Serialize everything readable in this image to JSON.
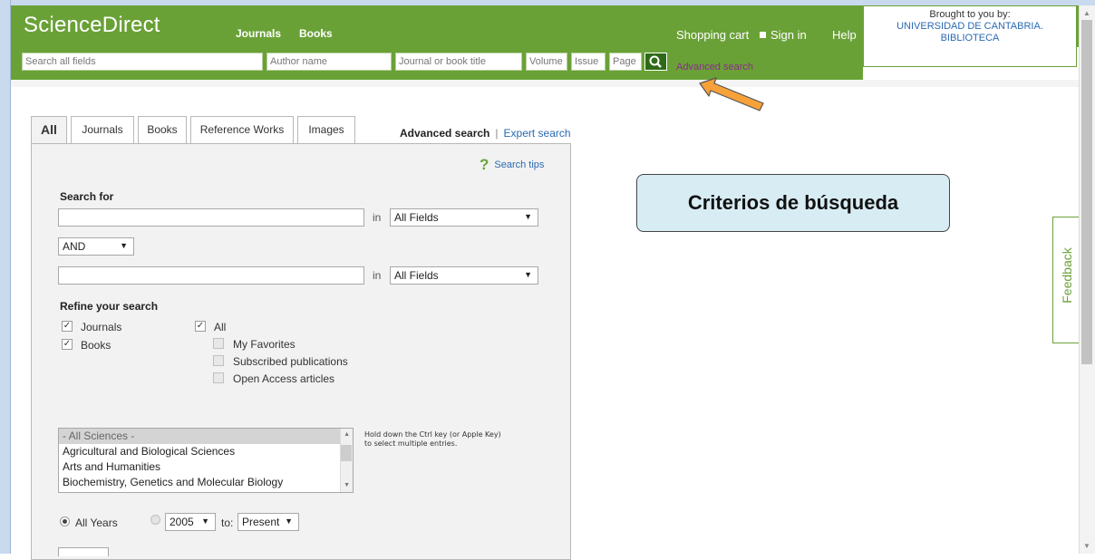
{
  "header": {
    "logo": "ScienceDirect",
    "nav": [
      "Journals",
      "Books"
    ],
    "shopping_cart": "Shopping cart",
    "sign_in": "Sign in",
    "help": "Help",
    "brought_label": "Brought to you by:",
    "institution_line1": "UNIVERSIDAD DE CANTABRIA.",
    "institution_line2": "BIBLIOTECA",
    "brand_color": "#6aa137"
  },
  "quick_search": {
    "all_fields_placeholder": "Search all fields",
    "author_placeholder": "Author name",
    "journal_placeholder": "Journal or book title",
    "volume_placeholder": "Volume",
    "issue_placeholder": "Issue",
    "page_placeholder": "Page",
    "advanced_link": "Advanced search"
  },
  "tabs": [
    "All",
    "Journals",
    "Books",
    "Reference Works",
    "Images"
  ],
  "search_mode": {
    "current": "Advanced search",
    "separator": "|",
    "expert": "Expert search"
  },
  "form": {
    "tips_label": "Search tips",
    "search_for_label": "Search for",
    "in_label": "in",
    "field1_select": "All Fields",
    "operator_select": "AND",
    "field2_select": "All Fields",
    "refine_label": "Refine your search",
    "content_types": [
      {
        "label": "Journals",
        "checked": true
      },
      {
        "label": "Books",
        "checked": true
      }
    ],
    "access_all": {
      "label": "All",
      "checked": true
    },
    "access_options": [
      {
        "label": "My Favorites",
        "checked": false
      },
      {
        "label": "Subscribed publications",
        "checked": false
      },
      {
        "label": "Open Access articles",
        "checked": false
      }
    ],
    "subjects": [
      "- All Sciences -",
      "Agricultural and Biological Sciences",
      "Arts and Humanities",
      "Biochemistry, Genetics and Molecular Biology"
    ],
    "multi_select_hint_line1": "Hold down the Ctrl key (or Apple Key)",
    "multi_select_hint_line2": "to select multiple entries.",
    "all_years_label": "All Years",
    "from_year": "2005",
    "to_label": "to:",
    "to_year": "Present"
  },
  "annotation": {
    "callout": "Criterios de búsqueda",
    "callout_bg": "#d8ecf4",
    "arrow_color": "#f7a13a"
  },
  "feedback_tab": "Feedback"
}
